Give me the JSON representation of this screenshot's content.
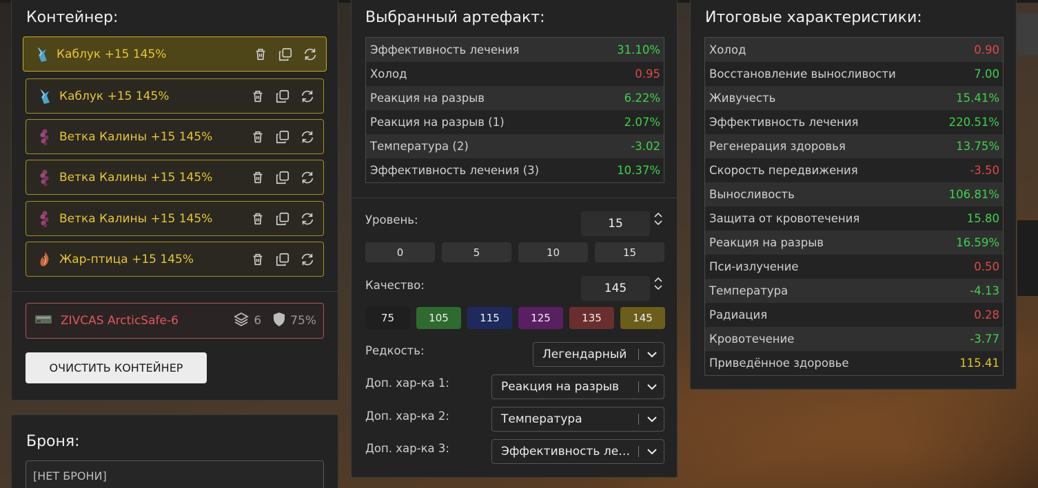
{
  "container": {
    "title": "Контейнер:",
    "items": [
      {
        "name": "Каблук +15 145%",
        "icon": "kabluk-artifact-icon"
      },
      {
        "name": "Каблук +15 145%",
        "icon": "kabluk-artifact-icon"
      },
      {
        "name": "Ветка Калины +15 145%",
        "icon": "vetka-kaliny-artifact-icon"
      },
      {
        "name": "Ветка Калины +15 145%",
        "icon": "vetka-kaliny-artifact-icon"
      },
      {
        "name": "Ветка Калины +15 145%",
        "icon": "vetka-kaliny-artifact-icon"
      },
      {
        "name": "Жар-птица +15 145%",
        "icon": "zhar-ptica-artifact-icon"
      }
    ],
    "container_name": "ZIVCAS ArcticSafe-6",
    "slots": "6",
    "protection": "75%",
    "clear_button": "ОЧИСТИТЬ КОНТЕЙНЕР"
  },
  "armor": {
    "title": "Броня:",
    "value": "[НЕТ БРОНИ]"
  },
  "artifact": {
    "title": "Выбранный артефакт:",
    "stats": [
      {
        "label": "Эффективность лечения",
        "value": "31.10%",
        "tone": "pos"
      },
      {
        "label": "Холод",
        "value": "0.95",
        "tone": "neg"
      },
      {
        "label": "Реакция на разрыв",
        "value": "6.22%",
        "tone": "pos"
      },
      {
        "label": "Реакция на разрыв (1)",
        "value": "2.07%",
        "tone": "pos"
      },
      {
        "label": "Температура (2)",
        "value": "-3.02",
        "tone": "pos"
      },
      {
        "label": "Эффективность лечения (3)",
        "value": "10.37%",
        "tone": "pos"
      }
    ],
    "level_label": "Уровень:",
    "level_value": "15",
    "level_presets": [
      "0",
      "5",
      "10",
      "15"
    ],
    "quality_label": "Качество:",
    "quality_value": "145",
    "quality_presets": [
      {
        "label": "75",
        "color": "#1f1f1f"
      },
      {
        "label": "105",
        "color": "#2e6b2e"
      },
      {
        "label": "115",
        "color": "#1e2a5e"
      },
      {
        "label": "125",
        "color": "#5a1f62"
      },
      {
        "label": "135",
        "color": "#6b2e2e"
      },
      {
        "label": "145",
        "color": "#6b5d1a"
      }
    ],
    "rarity_label": "Редкость:",
    "rarity_value": "Легендарный",
    "extra1_label": "Доп. хар-ка 1:",
    "extra1_value": "Реакция на разрыв",
    "extra2_label": "Доп. хар-ка 2:",
    "extra2_value": "Температура",
    "extra3_label": "Доп. хар-ка 3:",
    "extra3_value": "Эффективность лечения"
  },
  "totals": {
    "title": "Итоговые характеристики:",
    "stats": [
      {
        "label": "Холод",
        "value": "0.90",
        "tone": "neg"
      },
      {
        "label": "Восстановление выносливости",
        "value": "7.00",
        "tone": "pos"
      },
      {
        "label": "Живучесть",
        "value": "15.41%",
        "tone": "pos"
      },
      {
        "label": "Эффективность лечения",
        "value": "220.51%",
        "tone": "pos"
      },
      {
        "label": "Регенерация здоровья",
        "value": "13.75%",
        "tone": "pos"
      },
      {
        "label": "Скорость передвижения",
        "value": "-3.50",
        "tone": "neg"
      },
      {
        "label": "Выносливость",
        "value": "106.81%",
        "tone": "pos"
      },
      {
        "label": "Защита от кровотечения",
        "value": "15.80",
        "tone": "pos"
      },
      {
        "label": "Реакция на разрыв",
        "value": "16.59%",
        "tone": "pos"
      },
      {
        "label": "Пси-излучение",
        "value": "0.50",
        "tone": "neg"
      },
      {
        "label": "Температура",
        "value": "-4.13",
        "tone": "pos"
      },
      {
        "label": "Радиация",
        "value": "0.28",
        "tone": "neg"
      },
      {
        "label": "Кровотечение",
        "value": "-3.77",
        "tone": "pos"
      },
      {
        "label": "Приведённое здоровье",
        "value": "115.41",
        "tone": "yel"
      }
    ]
  }
}
